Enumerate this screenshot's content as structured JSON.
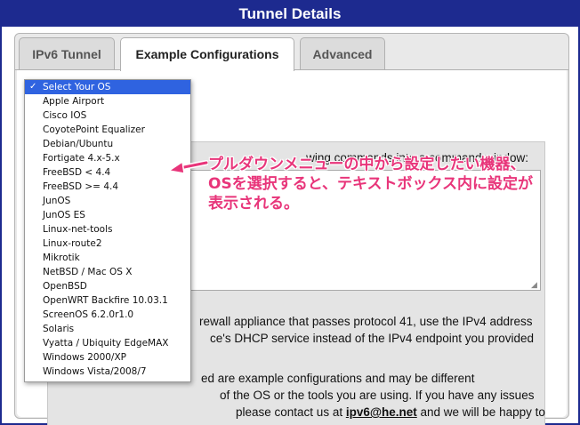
{
  "window": {
    "title": "Tunnel Details"
  },
  "tabs": [
    {
      "label": "IPv6 Tunnel",
      "active": false
    },
    {
      "label": "Example Configurations",
      "active": true
    },
    {
      "label": "Advanced",
      "active": false
    }
  ],
  "instructions": {
    "visible_text": "wing commands into a command window:",
    "para1_line1": "rewall appliance that passes protocol 41, use the IPv4 address",
    "para1_line2": "ce's DHCP service instead of the IPv4 endpoint you provided",
    "para2_line1": "ed are example configurations and may be different",
    "para2_line2": "of the OS or the tools you are using. If you have any issues",
    "para2_line3a": "please contact us at ",
    "email": "ipv6@he.net",
    "para2_line3b": " and we will be happy to"
  },
  "os_select": {
    "selected": "Select Your OS",
    "check_mark": "✓",
    "options": [
      "Select Your OS",
      "Apple Airport",
      "Cisco IOS",
      "CoyotePoint Equalizer",
      "Debian/Ubuntu",
      "Fortigate 4.x-5.x",
      "FreeBSD < 4.4",
      "FreeBSD >= 4.4",
      "JunOS",
      "JunOS ES",
      "Linux-net-tools",
      "Linux-route2",
      "Mikrotik",
      "NetBSD / Mac OS X",
      "OpenBSD",
      "OpenWRT Backfire 10.03.1",
      "ScreenOS 6.2.0r1.0",
      "Solaris",
      "Vyatta / Ubiquity EdgeMAX",
      "Windows 2000/XP",
      "Windows Vista/2008/7"
    ]
  },
  "annotation": {
    "line1": "プルダウンメニューの中から設定したい機器、",
    "line2": "OSを選択すると、テキストボックス内に設定が",
    "line3": "表示される。",
    "color": "#e8357a"
  },
  "colors": {
    "title_bar": "#1d2a8f",
    "selection": "#2f63e0"
  }
}
